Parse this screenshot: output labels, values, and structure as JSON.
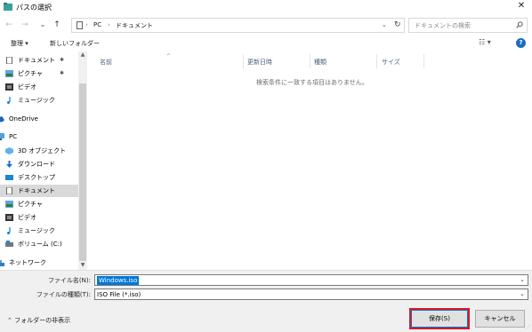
{
  "window": {
    "title": "パスの選択",
    "close_glyph": "✕"
  },
  "nav": {
    "back_glyph": "←",
    "forward_glyph": "→",
    "recent_glyph": "⌄",
    "up_glyph": "↑",
    "breadcrumb": [
      "PC",
      "ドキュメント"
    ],
    "separator": "›",
    "refresh_glyph": "↻",
    "dropdown_glyph": "⌄",
    "search_placeholder": "ドキュメントの検索"
  },
  "toolbar": {
    "organize_label": "整理 ▾",
    "new_folder_label": "新しいフォルダー",
    "view_glyph": "☷ ▾",
    "help_glyph": "?"
  },
  "sidebar": {
    "items": [
      {
        "label": "ドキュメント",
        "icon": "document-icon",
        "pinned": true
      },
      {
        "label": "ピクチャ",
        "icon": "pictures-icon",
        "pinned": true
      },
      {
        "label": "ビデオ",
        "icon": "video-icon",
        "pinned": false
      },
      {
        "label": "ミュージック",
        "icon": "music-icon",
        "pinned": false
      },
      {
        "label": "OneDrive",
        "icon": "onedrive-icon",
        "pinned": false
      },
      {
        "label": "PC",
        "icon": "pc-icon",
        "pinned": false
      },
      {
        "label": "3D オブジェクト",
        "icon": "3d-objects-icon",
        "pinned": false
      },
      {
        "label": "ダウンロード",
        "icon": "download-icon",
        "pinned": false
      },
      {
        "label": "デスクトップ",
        "icon": "desktop-icon",
        "pinned": false
      },
      {
        "label": "ドキュメント",
        "icon": "document-icon",
        "pinned": false,
        "selected": true
      },
      {
        "label": "ピクチャ",
        "icon": "pictures-icon",
        "pinned": false
      },
      {
        "label": "ビデオ",
        "icon": "video-icon",
        "pinned": false
      },
      {
        "label": "ミュージック",
        "icon": "music-icon",
        "pinned": false
      },
      {
        "label": "ボリューム (C:)",
        "icon": "drive-icon",
        "pinned": false
      },
      {
        "label": "ネットワーク",
        "icon": "network-icon",
        "pinned": false
      }
    ],
    "pin_glyph": "📌"
  },
  "filelist": {
    "columns": [
      "名前",
      "更新日時",
      "種類",
      "サイズ"
    ],
    "sort_glyph": "^",
    "empty_message": "検索条件に一致する項目はありません。"
  },
  "bottom": {
    "filename_label": "ファイル名(N):",
    "filename_value": "Windows.iso",
    "filetype_label": "ファイルの種類(T):",
    "filetype_value": "ISO File (*.iso)",
    "hide_folders_label": "フォルダーの非表示",
    "save_label": "保存(S)",
    "cancel_label": "キャンセル"
  },
  "colors": {
    "accent": "#0078d7",
    "highlight_box": "#e0161e"
  }
}
